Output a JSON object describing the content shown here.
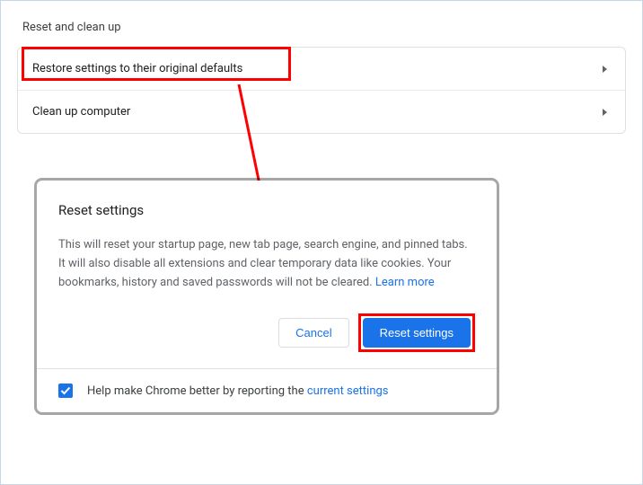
{
  "section": {
    "title": "Reset and clean up",
    "rows": [
      {
        "label": "Restore settings to their original defaults"
      },
      {
        "label": "Clean up computer"
      }
    ]
  },
  "dialog": {
    "title": "Reset settings",
    "body_text": "This will reset your startup page, new tab page, search engine, and pinned tabs. It will also disable all extensions and clear temporary data like cookies. Your bookmarks, history and saved passwords will not be cleared. ",
    "learn_more": "Learn more",
    "cancel": "Cancel",
    "confirm": "Reset settings",
    "footer_text_prefix": "Help make Chrome better by reporting the ",
    "footer_link": "current settings",
    "checkbox_checked": true
  }
}
